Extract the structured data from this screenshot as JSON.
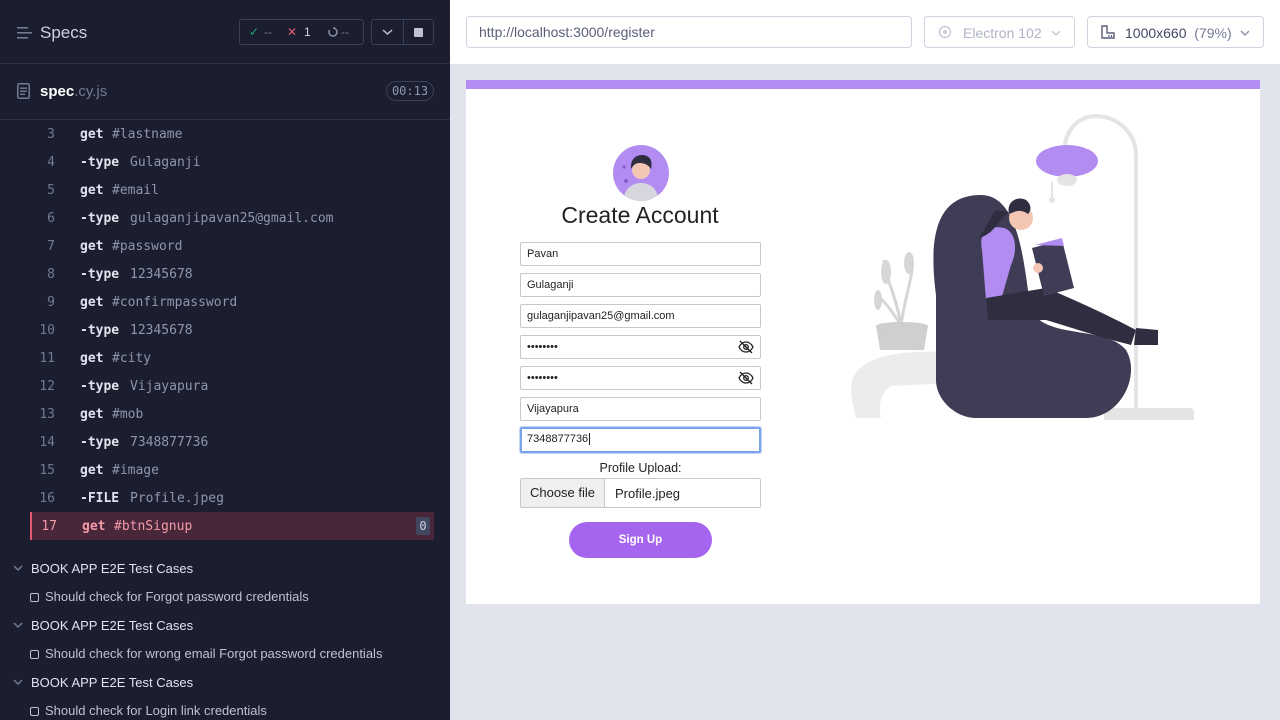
{
  "reporter": {
    "header": {
      "title": "Specs",
      "passed": "--",
      "failed": "1",
      "pending": "--"
    },
    "spec": {
      "name": "spec",
      "ext": ".cy.js",
      "duration": "00:13"
    },
    "commands": [
      {
        "num": "3",
        "name": "get",
        "arg": "#lastname"
      },
      {
        "num": "4",
        "name": "-type",
        "arg": "Gulaganji"
      },
      {
        "num": "5",
        "name": "get",
        "arg": "#email"
      },
      {
        "num": "6",
        "name": "-type",
        "arg": "gulaganjipavan25@gmail.com"
      },
      {
        "num": "7",
        "name": "get",
        "arg": "#password"
      },
      {
        "num": "8",
        "name": "-type",
        "arg": "12345678"
      },
      {
        "num": "9",
        "name": "get",
        "arg": "#confirmpassword"
      },
      {
        "num": "10",
        "name": "-type",
        "arg": "12345678"
      },
      {
        "num": "11",
        "name": "get",
        "arg": "#city"
      },
      {
        "num": "12",
        "name": "-type",
        "arg": "Vijayapura"
      },
      {
        "num": "13",
        "name": "get",
        "arg": "#mob"
      },
      {
        "num": "14",
        "name": "-type",
        "arg": "7348877736"
      },
      {
        "num": "15",
        "name": "get",
        "arg": "#image"
      },
      {
        "num": "16",
        "name": "-FILE",
        "arg": "Profile.jpeg"
      },
      {
        "num": "17",
        "name": "get",
        "arg": "#btnSignup",
        "badge": "0"
      }
    ],
    "suites": [
      {
        "title": "BOOK APP E2E Test Cases",
        "test": "Should check for Forgot password credentials"
      },
      {
        "title": "BOOK APP E2E Test Cases",
        "test": "Should check for wrong email Forgot password credentials"
      },
      {
        "title": "BOOK APP E2E Test Cases",
        "test": "Should check for Login link credentials"
      }
    ]
  },
  "aut_header": {
    "url": "http://localhost:3000/register",
    "browser": "Electron 102",
    "viewport": "1000x660",
    "scale": "(79%)"
  },
  "app": {
    "title": "Create Account",
    "fields": {
      "firstname": "Pavan",
      "lastname": "Gulaganji",
      "email": "gulaganjipavan25@gmail.com",
      "password": "••••••••",
      "confirmpassword": "••••••••",
      "city": "Vijayapura",
      "mobile": "7348877736"
    },
    "upload_label": "Profile Upload:",
    "choose_file": "Choose file",
    "file_name": "Profile.jpeg",
    "signup": "Sign Up"
  },
  "colors": {
    "reporter_bg": "#1b1e2e",
    "accent_purple": "#a665ee",
    "fail_red": "#e45770",
    "pass_green": "#1fa971"
  }
}
